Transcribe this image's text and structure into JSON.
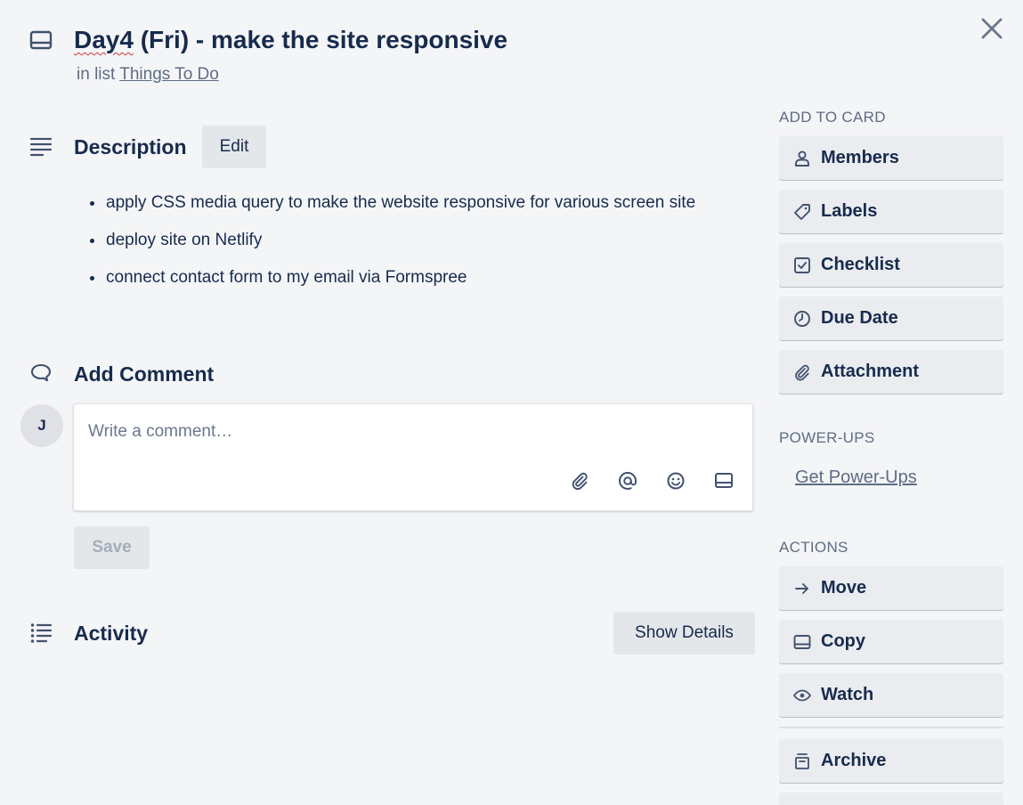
{
  "header": {
    "title_prefix": "Day4",
    "title_rest": " (Fri) - make the site responsive",
    "in_list_prefix": "in list ",
    "list_name": "Things To Do"
  },
  "description": {
    "title": "Description",
    "edit_label": "Edit",
    "items": [
      "apply CSS media query to make the website responsive for various screen site",
      "deploy site on Netlify",
      "connect contact form to my email via Formspree"
    ]
  },
  "comment": {
    "title": "Add Comment",
    "avatar_initial": "J",
    "placeholder": "Write a comment…",
    "save_label": "Save"
  },
  "activity": {
    "title": "Activity",
    "show_details_label": "Show Details"
  },
  "sidebar": {
    "add_to_card": {
      "heading": "ADD TO CARD",
      "items": [
        "Members",
        "Labels",
        "Checklist",
        "Due Date",
        "Attachment"
      ]
    },
    "power_ups": {
      "heading": "POWER-UPS",
      "link": "Get Power-Ups"
    },
    "actions": {
      "heading": "ACTIONS",
      "items": [
        "Move",
        "Copy",
        "Watch",
        "Archive"
      ]
    }
  },
  "colors": {
    "background": "#f4f5f7",
    "text": "#172b4d",
    "muted": "#5e6c84",
    "button": "#eaecf0"
  }
}
